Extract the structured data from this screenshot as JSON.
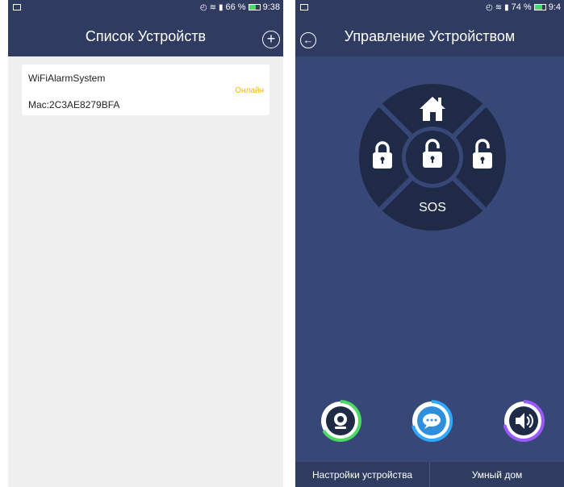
{
  "left_screen": {
    "status": {
      "battery": "66 %",
      "battery_level": 0.66,
      "time": "9:38"
    },
    "title": "Список Устройств",
    "add_icon": "plus-circle-icon",
    "device": {
      "name": "WiFiAlarmSystem",
      "mac": "Mac:2C3AE8279BFA",
      "status": "Онлайн",
      "status_color": "#f7b500"
    }
  },
  "right_screen": {
    "status": {
      "battery": "74 %",
      "battery_level": 0.74,
      "time": "9:4"
    },
    "title": "Управление Устройством",
    "back_icon": "arrow-left-icon",
    "control": {
      "home_icon": "home-icon",
      "arm_icon": "lock-closed-icon",
      "disarm_icon": "lock-open-icon",
      "partial_icon": "lock-open-icon",
      "sos_label": "SOS"
    },
    "quick_actions": [
      {
        "icon": "camera-icon",
        "ring_color": "#4cd964"
      },
      {
        "icon": "chat-icon",
        "ring_color": "#2fa8ff"
      },
      {
        "icon": "speaker-icon",
        "ring_color": "#9b59ff"
      }
    ],
    "tabs": [
      "Настройки устройства",
      "Умный дом"
    ]
  },
  "colors": {
    "header": "#2f3b61",
    "panel_background": "#374777",
    "wheel": "#1f2a47",
    "list_background": "#efefef"
  }
}
